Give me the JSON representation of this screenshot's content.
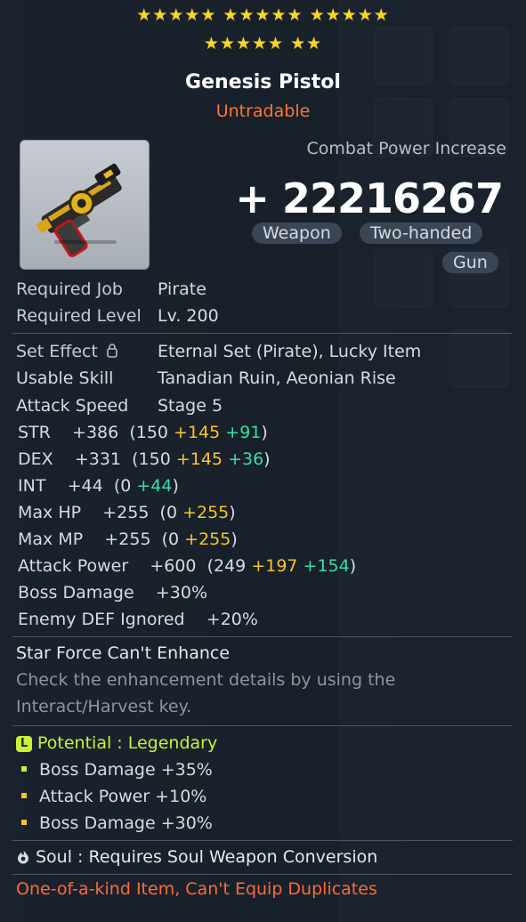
{
  "stars": {
    "row1": "★★★★★  ★★★★★  ★★★★★",
    "row2": "★★★★★  ★★"
  },
  "item": {
    "name": "Genesis Pistol",
    "tradability": "Untradable",
    "icon": "pistol-icon"
  },
  "combat_power": {
    "label": "Combat Power Increase",
    "value": "+ 22216267"
  },
  "tags": [
    "Weapon",
    "Two-handed",
    "Gun"
  ],
  "requirements": {
    "job_label": "Required Job",
    "job_value": "Pirate",
    "level_label": "Required Level",
    "level_value": "Lv. 200"
  },
  "info": {
    "set_label": "Set Effect",
    "set_value": "Eternal Set (Pirate), Lucky Item",
    "skill_label": "Usable Skill",
    "skill_value": "Tanadian Ruin, Aeonian Rise",
    "speed_label": "Attack Speed",
    "speed_value": "Stage 5"
  },
  "stats": [
    {
      "name": "STR",
      "total": "+386",
      "open": "(150 ",
      "y": "+145",
      "g": "+91",
      "close": ")"
    },
    {
      "name": "DEX",
      "total": "+331",
      "open": "(150 ",
      "y": "+145",
      "g": "+36",
      "close": ")"
    },
    {
      "name": "INT",
      "total": "+44",
      "open": "(0 ",
      "y": "",
      "g": "+44",
      "close": ")"
    },
    {
      "name": "Max HP",
      "total": "+255",
      "open": "(0 ",
      "y": "+255",
      "g": "",
      "close": ")"
    },
    {
      "name": "Max MP",
      "total": "+255",
      "open": "(0 ",
      "y": "+255",
      "g": "",
      "close": ")"
    },
    {
      "name": "Attack Power",
      "total": "+600",
      "open": "(249 ",
      "y": "+197",
      "g": "+154",
      "close": ")"
    },
    {
      "name": "Boss Damage",
      "total": "+30%",
      "open": "",
      "y": "",
      "g": "",
      "close": ""
    },
    {
      "name": "Enemy DEF Ignored",
      "total": "+20%",
      "open": "",
      "y": "",
      "g": "",
      "close": ""
    }
  ],
  "starforce": {
    "title": "Star Force Can't Enhance",
    "hint1": "Check the enhancement details by using the",
    "hint2": "Interact/Harvest key."
  },
  "potential": {
    "badge": "L",
    "title": "Potential : Legendary",
    "lines": [
      "Boss Damage +35%",
      "Attack Power +10%",
      "Boss Damage +30%"
    ]
  },
  "soul": {
    "text": "Soul : Requires Soul Weapon Conversion"
  },
  "footer": {
    "warning": "One-of-a-kind Item, Can't Equip Duplicates"
  },
  "colors": {
    "stars": "#f7d52a",
    "untradable": "#ff7733",
    "bonus_yellow": "#f5c52a",
    "bonus_green": "#39e0a0",
    "legendary": "#c8f23a",
    "warning": "#ff6a3a"
  }
}
